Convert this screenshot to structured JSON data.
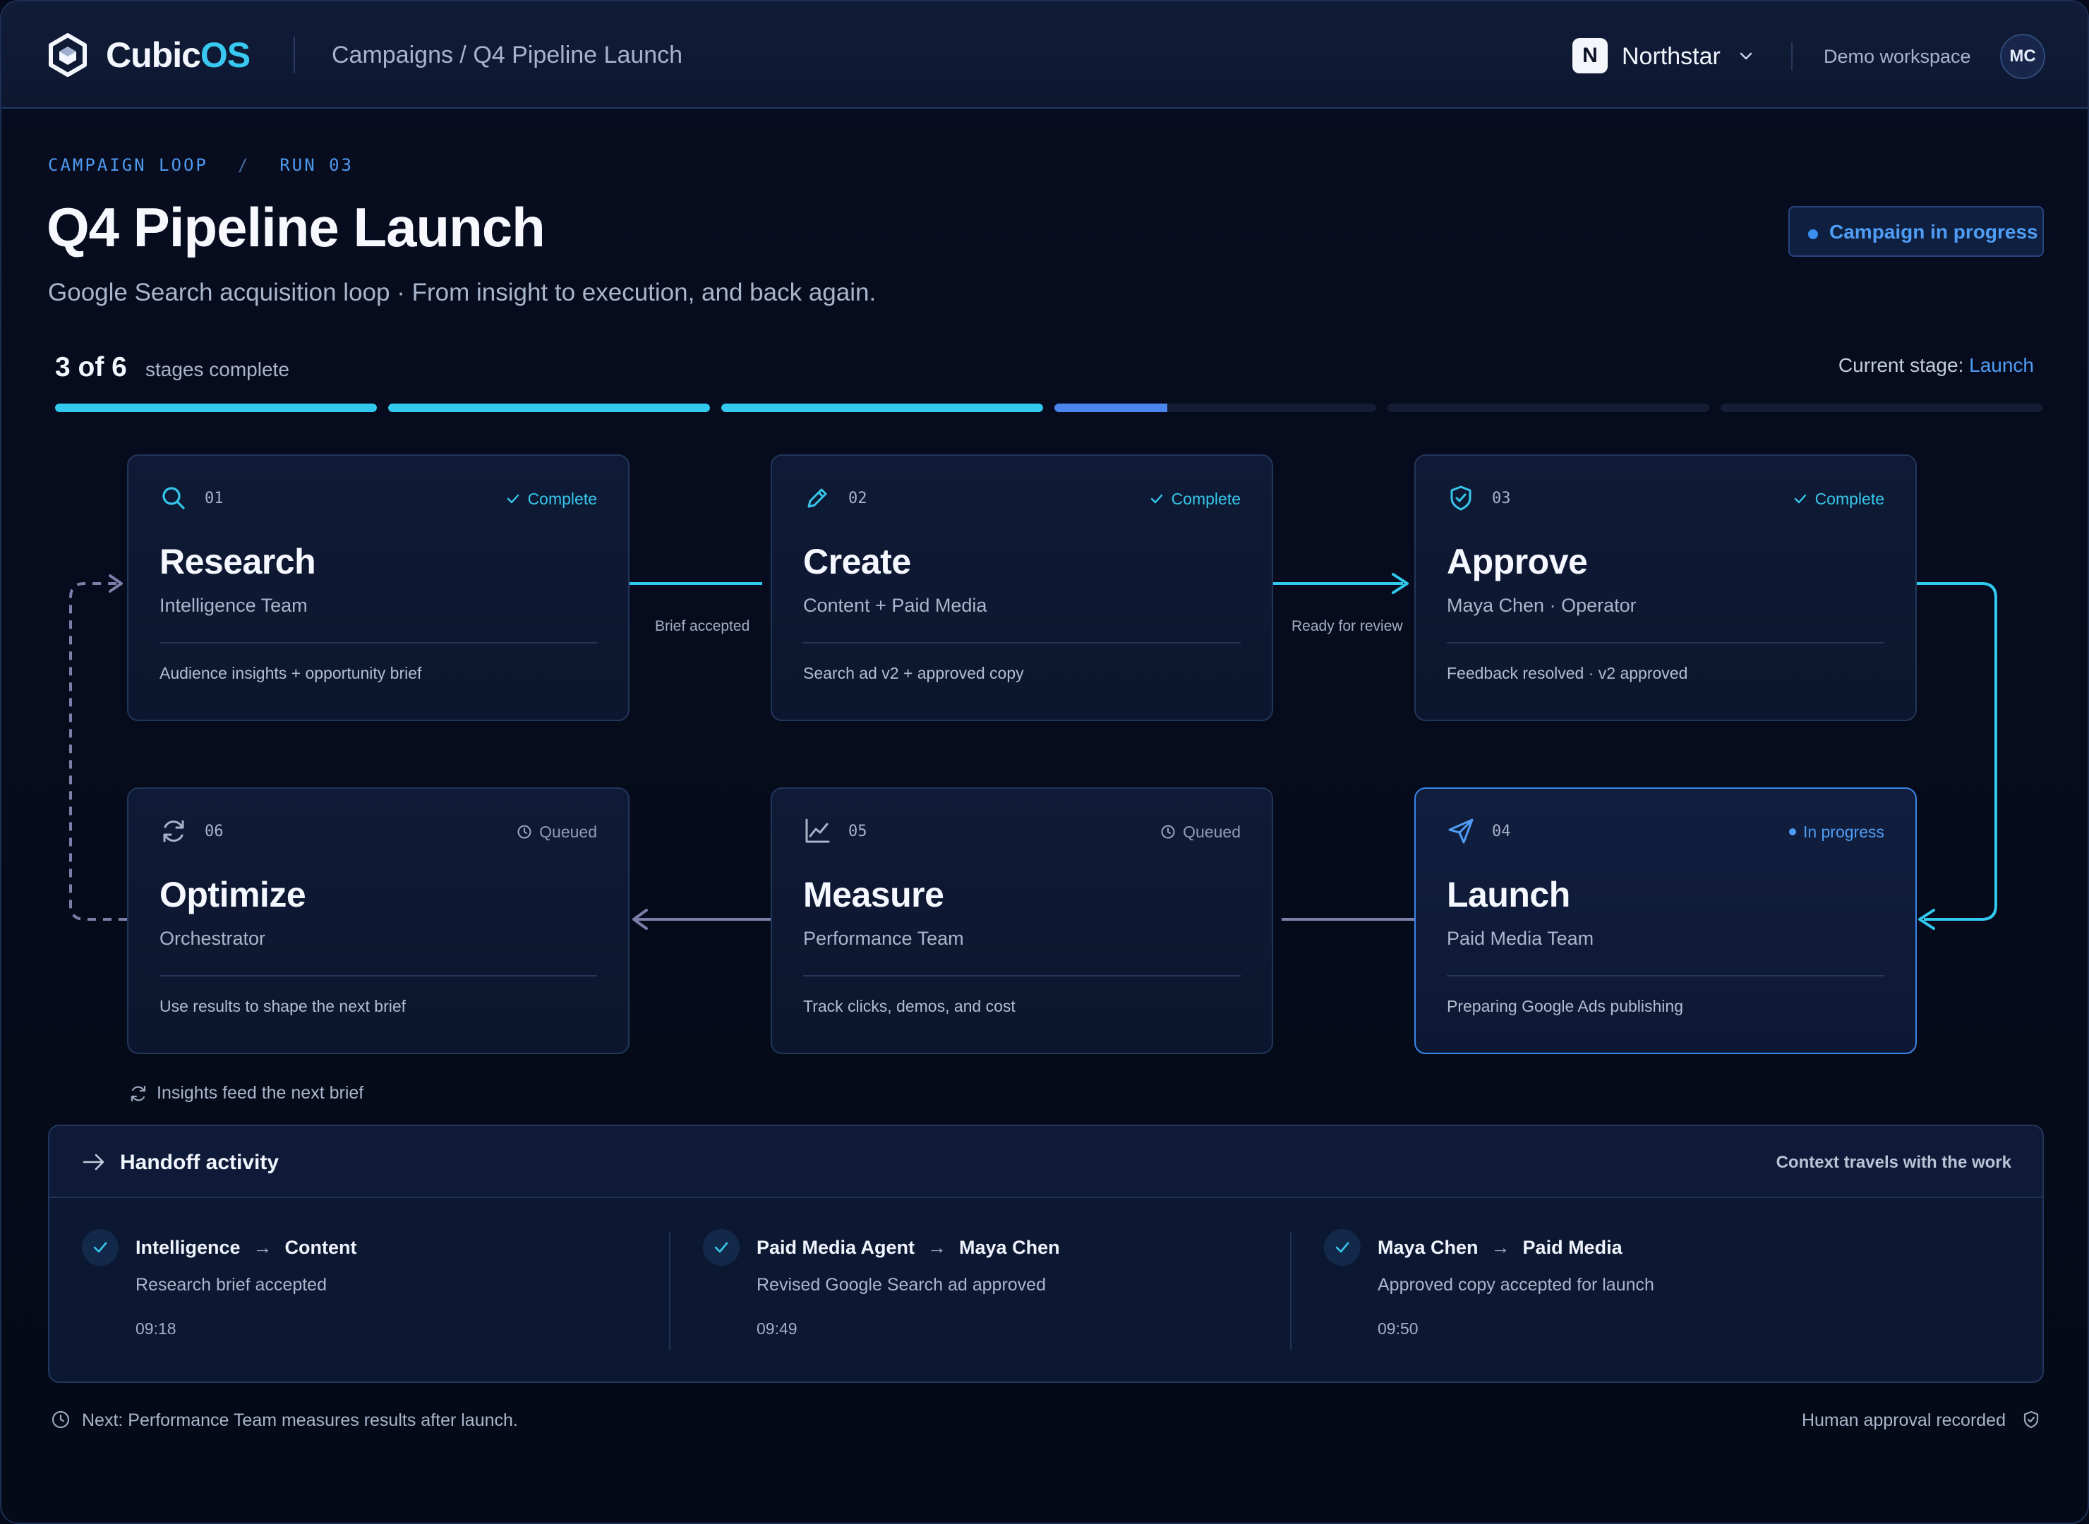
{
  "brand": {
    "name_part1": "Cubic",
    "name_part2": "OS"
  },
  "breadcrumb": "Campaigns / Q4 Pipeline Launch",
  "workspace": {
    "badge": "N",
    "name": "Northstar",
    "mode": "Demo workspace"
  },
  "user": {
    "initials": "MC"
  },
  "header": {
    "eyebrow_loop": "CAMPAIGN LOOP",
    "eyebrow_sep": "/",
    "eyebrow_run": "RUN 03",
    "title": "Q4 Pipeline Launch",
    "subtitle": "Google Search acquisition loop · From insight to execution, and back again.",
    "status": "Campaign in progress"
  },
  "progress": {
    "count": "3 of 6",
    "label": "stages complete",
    "current_prefix": "Current stage:",
    "current_stage": "Launch",
    "segments": [
      1,
      1,
      1,
      0.35,
      0,
      0
    ]
  },
  "stages": [
    {
      "num": "01",
      "name": "Research",
      "team": "Intelligence Team",
      "note": "Audience insights + opportunity brief",
      "status": "Complete",
      "state": "complete",
      "icon": "search-icon"
    },
    {
      "num": "02",
      "name": "Create",
      "team": "Content + Paid Media",
      "note": "Search ad v2 + approved copy",
      "status": "Complete",
      "state": "complete",
      "icon": "pencil-icon"
    },
    {
      "num": "03",
      "name": "Approve",
      "team": "Maya Chen · Operator",
      "note": "Feedback resolved · v2 approved",
      "status": "Complete",
      "state": "complete",
      "icon": "shield-check-icon"
    },
    {
      "num": "04",
      "name": "Launch",
      "team": "Paid Media Team",
      "note": "Preparing Google Ads publishing",
      "status": "In progress",
      "state": "progress",
      "icon": "send-icon"
    },
    {
      "num": "05",
      "name": "Measure",
      "team": "Performance Team",
      "note": "Track clicks, demos, and cost",
      "status": "Queued",
      "state": "queued",
      "icon": "chart-line-icon"
    },
    {
      "num": "06",
      "name": "Optimize",
      "team": "Orchestrator",
      "note": "Use results to shape the next brief",
      "status": "Queued",
      "state": "queued",
      "icon": "refresh-icon"
    }
  ],
  "connectors": {
    "brief_accepted": "Brief accepted",
    "ready_for_review": "Ready for review"
  },
  "loop_note": "Insights feed the next brief",
  "handoff": {
    "title": "Handoff activity",
    "subtitle": "Context travels with the work",
    "items": [
      {
        "from": "Intelligence",
        "arrow": "→",
        "to": "Content",
        "desc": "Research brief accepted",
        "time": "09:18"
      },
      {
        "from": "Paid Media Agent",
        "arrow": "→",
        "to": "Maya Chen",
        "desc": "Revised Google Search ad approved",
        "time": "09:49"
      },
      {
        "from": "Maya Chen",
        "arrow": "→",
        "to": "Paid Media",
        "desc": "Approved copy accepted for launch",
        "time": "09:50"
      }
    ]
  },
  "footer": {
    "next": "Next: Performance Team measures results after launch.",
    "approval": "Human approval recorded"
  },
  "colors": {
    "accent_cyan": "#31c9ee",
    "accent_blue": "#4f9df5",
    "background": "#060b1b"
  }
}
